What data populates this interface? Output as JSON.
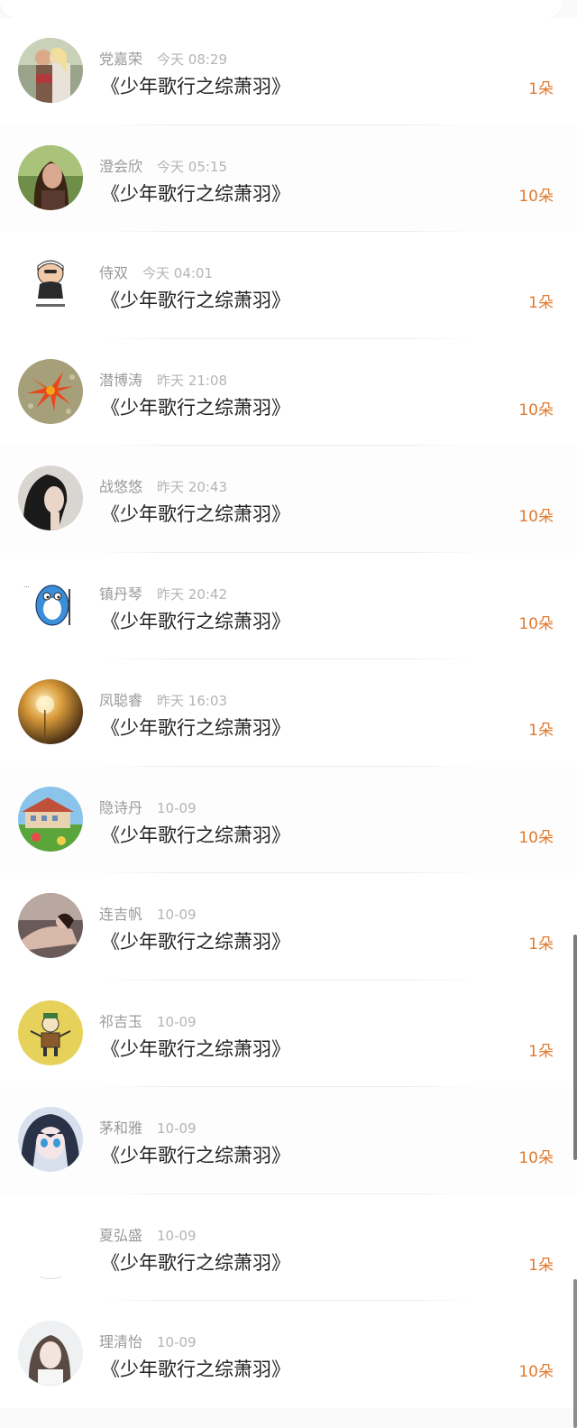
{
  "accent_color": "#e07a2e",
  "rows": [
    {
      "name": "党嘉荣",
      "time": "今天 08:29",
      "title": "《少年歌行之综萧羽》",
      "count": "1朵",
      "avatar_icon": "couple-photo-avatar"
    },
    {
      "name": "澄会欣",
      "time": "今天 05:15",
      "title": "《少年歌行之综萧羽》",
      "count": "10朵",
      "avatar_icon": "woman-portrait-avatar"
    },
    {
      "name": "侍双",
      "time": "今天 04:01",
      "title": "《少年歌行之综萧羽》",
      "count": "1朵",
      "avatar_icon": "cartoon-man-avatar"
    },
    {
      "name": "潜博涛",
      "time": "昨天 21:08",
      "title": "《少年歌行之综萧羽》",
      "count": "10朵",
      "avatar_icon": "red-flower-avatar"
    },
    {
      "name": "战悠悠",
      "time": "昨天 20:43",
      "title": "《少年歌行之综萧羽》",
      "count": "10朵",
      "avatar_icon": "dark-hair-portrait-avatar"
    },
    {
      "name": "镇丹琴",
      "time": "昨天 20:42",
      "title": "《少年歌行之综萧羽》",
      "count": "10朵",
      "avatar_icon": "blue-cartoon-avatar"
    },
    {
      "name": "凤聪睿",
      "time": "昨天 16:03",
      "title": "《少年歌行之综萧羽》",
      "count": "1朵",
      "avatar_icon": "dandelion-sunset-avatar"
    },
    {
      "name": "隐诗丹",
      "time": "10-09",
      "title": "《少年歌行之综萧羽》",
      "count": "10朵",
      "avatar_icon": "house-garden-avatar"
    },
    {
      "name": "连吉帆",
      "time": "10-09",
      "title": "《少年歌行之综萧羽》",
      "count": "1朵",
      "avatar_icon": "woman-lying-avatar"
    },
    {
      "name": "祁吉玉",
      "time": "10-09",
      "title": "《少年歌行之综萧羽》",
      "count": "1朵",
      "avatar_icon": "cartoon-figure-yellow-avatar"
    },
    {
      "name": "茅和雅",
      "time": "10-09",
      "title": "《少年歌行之综萧羽》",
      "count": "10朵",
      "avatar_icon": "anime-girl-avatar"
    },
    {
      "name": "夏弘盛",
      "time": "10-09",
      "title": "《少年歌行之综萧羽》",
      "count": "1朵",
      "avatar_icon": "blank-avatar"
    },
    {
      "name": "理清怡",
      "time": "10-09",
      "title": "《少年歌行之综萧羽》",
      "count": "10朵",
      "avatar_icon": "woman-light-portrait-avatar"
    }
  ]
}
